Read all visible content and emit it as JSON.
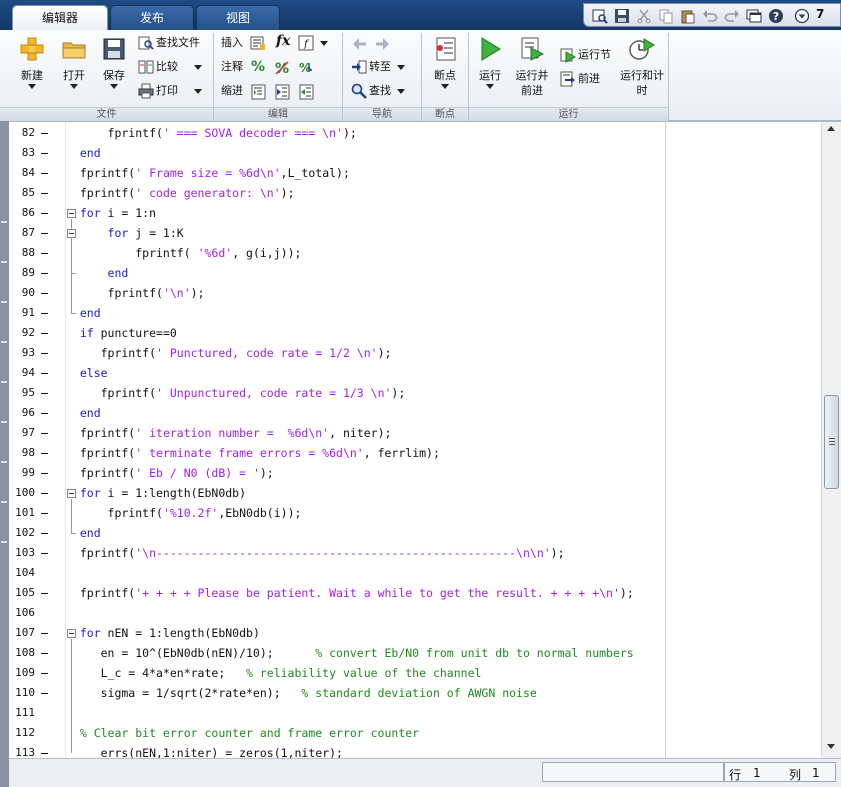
{
  "tabs": [
    {
      "label": "编辑器",
      "active": true
    },
    {
      "label": "发布",
      "active": false
    },
    {
      "label": "视图",
      "active": false
    }
  ],
  "quick_access": {
    "overflow_label": "7"
  },
  "ribbon": {
    "sections": {
      "file": "文件",
      "edit": "编辑",
      "navigate": "导航",
      "breakpoints": "断点",
      "run": "运行"
    },
    "file": {
      "new": "新建",
      "open": "打开",
      "save": "保存",
      "find_files": "查找文件",
      "compare": "比较",
      "print": "打印"
    },
    "edit": {
      "insert": "插入",
      "comment": "注释",
      "indent": "缩进",
      "fx": "fx"
    },
    "navigate": {
      "goto": "转至",
      "find": "查找"
    },
    "breakpoints": {
      "breakpoints": "断点"
    },
    "run": {
      "run": "运行",
      "run_and_advance": "运行并前进",
      "run_section": "运行节",
      "advance": "前进",
      "run_and_time": "运行和计时"
    }
  },
  "editor": {
    "lines": [
      {
        "n": "82",
        "exec": true,
        "segs": [
          [
            "t",
            "      fprintf("
          ],
          [
            "s",
            "' === SOVA decoder === \\n'"
          ],
          [
            "t",
            ");"
          ]
        ]
      },
      {
        "n": "83",
        "exec": true,
        "segs": [
          [
            "k",
            "  end"
          ]
        ]
      },
      {
        "n": "84",
        "exec": true,
        "segs": [
          [
            "t",
            "  fprintf("
          ],
          [
            "s",
            "' Frame size = %6d\\n'"
          ],
          [
            "t",
            ",L_total);"
          ]
        ]
      },
      {
        "n": "85",
        "exec": true,
        "segs": [
          [
            "t",
            "  fprintf("
          ],
          [
            "s",
            "' code generator: \\n'"
          ],
          [
            "t",
            ");"
          ]
        ]
      },
      {
        "n": "86",
        "exec": true,
        "segs": [
          [
            "k",
            "  for"
          ],
          [
            "t",
            " i = 1:n"
          ]
        ]
      },
      {
        "n": "87",
        "exec": true,
        "segs": [
          [
            "k",
            "      for"
          ],
          [
            "t",
            " j = 1:K"
          ]
        ]
      },
      {
        "n": "88",
        "exec": true,
        "segs": [
          [
            "t",
            "          fprintf( "
          ],
          [
            "s",
            "'%6d'"
          ],
          [
            "t",
            ", g(i,j));"
          ]
        ]
      },
      {
        "n": "89",
        "exec": true,
        "segs": [
          [
            "k",
            "      end"
          ]
        ]
      },
      {
        "n": "90",
        "exec": true,
        "segs": [
          [
            "t",
            "      fprintf("
          ],
          [
            "s",
            "'\\n'"
          ],
          [
            "t",
            ");"
          ]
        ]
      },
      {
        "n": "91",
        "exec": true,
        "segs": [
          [
            "k",
            "  end"
          ]
        ]
      },
      {
        "n": "92",
        "exec": true,
        "segs": [
          [
            "k",
            "  if"
          ],
          [
            "t",
            " puncture==0"
          ]
        ]
      },
      {
        "n": "93",
        "exec": true,
        "segs": [
          [
            "t",
            "     fprintf("
          ],
          [
            "s",
            "' Punctured, code rate = 1/2 \\n'"
          ],
          [
            "t",
            ");"
          ]
        ]
      },
      {
        "n": "94",
        "exec": true,
        "segs": [
          [
            "k",
            "  else"
          ]
        ]
      },
      {
        "n": "95",
        "exec": true,
        "segs": [
          [
            "t",
            "     fprintf("
          ],
          [
            "s",
            "' Unpunctured, code rate = 1/3 \\n'"
          ],
          [
            "t",
            ");"
          ]
        ]
      },
      {
        "n": "96",
        "exec": true,
        "segs": [
          [
            "k",
            "  end"
          ]
        ]
      },
      {
        "n": "97",
        "exec": true,
        "segs": [
          [
            "t",
            "  fprintf("
          ],
          [
            "s",
            "' iteration number =  %6d\\n'"
          ],
          [
            "t",
            ", niter);"
          ]
        ]
      },
      {
        "n": "98",
        "exec": true,
        "segs": [
          [
            "t",
            "  fprintf("
          ],
          [
            "s",
            "' terminate frame errors = %6d\\n'"
          ],
          [
            "t",
            ", ferrlim);"
          ]
        ]
      },
      {
        "n": "99",
        "exec": true,
        "segs": [
          [
            "t",
            "  fprintf("
          ],
          [
            "s",
            "' Eb / N0 (dB) = '"
          ],
          [
            "t",
            ");"
          ]
        ]
      },
      {
        "n": "100",
        "exec": true,
        "segs": [
          [
            "k",
            "  for"
          ],
          [
            "t",
            " i = 1:length(EbN0db)"
          ]
        ]
      },
      {
        "n": "101",
        "exec": true,
        "segs": [
          [
            "t",
            "      fprintf("
          ],
          [
            "s",
            "'%10.2f'"
          ],
          [
            "t",
            ",EbN0db(i));"
          ]
        ]
      },
      {
        "n": "102",
        "exec": true,
        "segs": [
          [
            "k",
            "  end"
          ]
        ]
      },
      {
        "n": "103",
        "exec": true,
        "segs": [
          [
            "t",
            "  fprintf("
          ],
          [
            "s",
            "'\\n----------------------------------------------------\\n\\n'"
          ],
          [
            "t",
            ");"
          ]
        ]
      },
      {
        "n": "104",
        "exec": false,
        "segs": []
      },
      {
        "n": "105",
        "exec": true,
        "segs": [
          [
            "t",
            "  fprintf("
          ],
          [
            "s",
            "'+ + + + Please be patient. Wait a while to get the result. + + + +\\n'"
          ],
          [
            "t",
            ");"
          ]
        ]
      },
      {
        "n": "106",
        "exec": false,
        "segs": []
      },
      {
        "n": "107",
        "exec": true,
        "segs": [
          [
            "k",
            "  for"
          ],
          [
            "t",
            " nEN = 1:length(EbN0db)"
          ]
        ]
      },
      {
        "n": "108",
        "exec": true,
        "segs": [
          [
            "t",
            "     en = 10^(EbN0db(nEN)/10);      "
          ],
          [
            "c",
            "% convert Eb/N0 from unit db to normal numbers"
          ]
        ]
      },
      {
        "n": "109",
        "exec": true,
        "segs": [
          [
            "t",
            "     L_c = 4*a*en*rate;   "
          ],
          [
            "c",
            "% reliability value of the channel"
          ]
        ]
      },
      {
        "n": "110",
        "exec": true,
        "segs": [
          [
            "t",
            "     sigma = 1/sqrt(2*rate*en);   "
          ],
          [
            "c",
            "% standard deviation of AWGN noise"
          ]
        ]
      },
      {
        "n": "111",
        "exec": false,
        "segs": []
      },
      {
        "n": "112",
        "exec": false,
        "segs": [
          [
            "c",
            "  % Clear bit error counter and frame error counter"
          ]
        ]
      },
      {
        "n": "113",
        "exec": true,
        "segs": [
          [
            "t",
            "     errs(nEN,1:niter) = zeros(1,niter);"
          ]
        ]
      }
    ]
  },
  "status": {
    "row_label": "行",
    "row_value": "1",
    "col_label": "列",
    "col_value": "1"
  },
  "colors": {
    "keyword": "#1919d9",
    "string": "#a020f0",
    "comment": "#1e8b1e"
  }
}
